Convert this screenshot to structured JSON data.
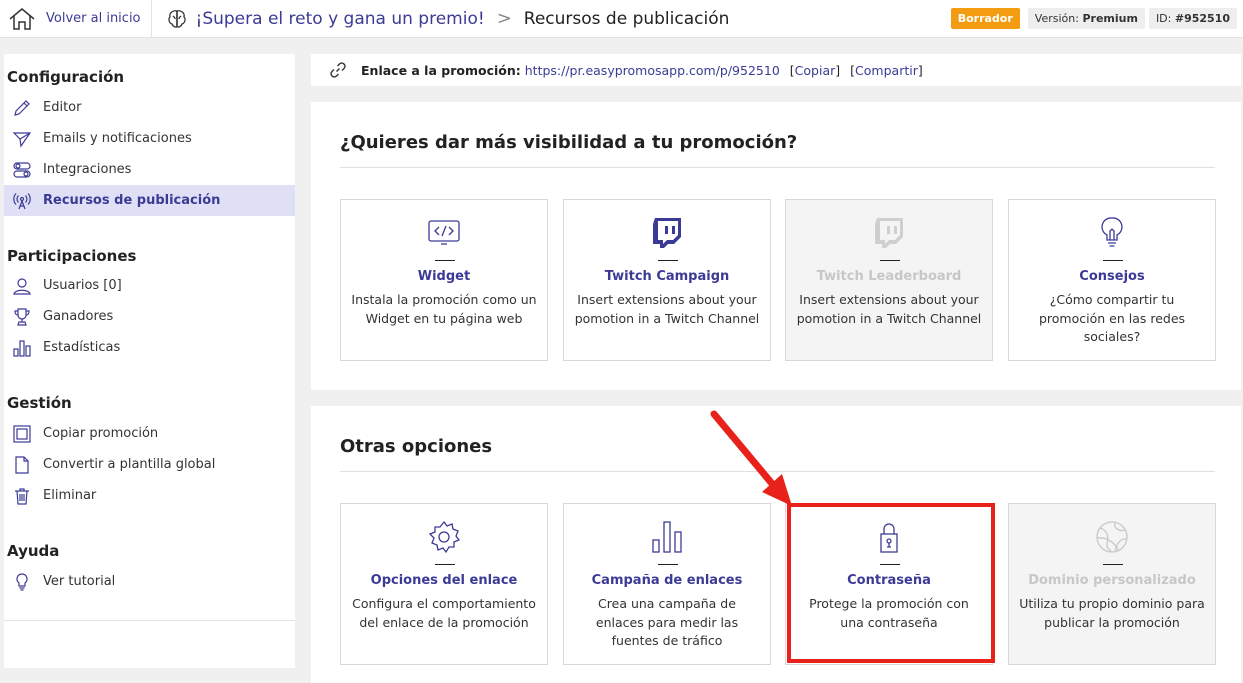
{
  "topbar": {
    "back_label": "Volver al inicio",
    "promo_title": "¡Supera el reto y gana un premio!",
    "separator": ">",
    "current_page": "Recursos de publicación",
    "status_badge": "Borrador",
    "version_label": "Versión:",
    "version_value": "Premium",
    "id_label": "ID:",
    "id_value": "#952510"
  },
  "sidebar": {
    "sections": [
      {
        "title": "Configuración",
        "items": [
          {
            "label": "Editor",
            "icon": "pencil-icon"
          },
          {
            "label": "Emails y notificaciones",
            "icon": "send-icon"
          },
          {
            "label": "Integraciones",
            "icon": "toggles-icon"
          },
          {
            "label": "Recursos de publicación",
            "icon": "broadcast-icon",
            "active": true
          }
        ]
      },
      {
        "title": "Participaciones",
        "items": [
          {
            "label": "Usuarios [0]",
            "icon": "user-icon"
          },
          {
            "label": "Ganadores",
            "icon": "trophy-icon"
          },
          {
            "label": "Estadísticas",
            "icon": "bar-chart-icon"
          }
        ]
      },
      {
        "title": "Gestión",
        "items": [
          {
            "label": "Copiar promoción",
            "icon": "copy-icon"
          },
          {
            "label": "Convertir a plantilla global",
            "icon": "document-icon"
          },
          {
            "label": "Eliminar",
            "icon": "trash-icon"
          }
        ]
      },
      {
        "title": "Ayuda",
        "items": [
          {
            "label": "Ver tutorial",
            "icon": "lightbulb-icon"
          }
        ]
      }
    ]
  },
  "linkbar": {
    "label": "Enlace a la promoción:",
    "url": "https://pr.easypromosapp.com/p/952510",
    "copy_label": "Copiar",
    "share_label": "Compartir"
  },
  "visibility": {
    "title": "¿Quieres dar más visibilidad a tu promoción?",
    "cards": [
      {
        "title": "Widget",
        "desc": "Instala la promoción como un Widget en tu página web",
        "icon": "code-icon",
        "disabled": false
      },
      {
        "title": "Twitch Campaign",
        "desc": "Insert extensions about your pomotion in a Twitch Channel",
        "icon": "twitch-icon",
        "disabled": false
      },
      {
        "title": "Twitch Leaderboard",
        "desc": "Insert extensions about your pomotion in a Twitch Channel",
        "icon": "twitch-icon",
        "disabled": true
      },
      {
        "title": "Consejos",
        "desc": "¿Cómo compartir tu promoción en las redes sociales?",
        "icon": "lightbulb-icon",
        "disabled": false
      }
    ]
  },
  "other": {
    "title": "Otras opciones",
    "cards": [
      {
        "title": "Opciones del enlace",
        "desc": "Configura el comportamiento del enlace de la promoción",
        "icon": "gear-icon",
        "disabled": false
      },
      {
        "title": "Campaña de enlaces",
        "desc": "Crea una campaña de enlaces para medir las fuentes de tráfico",
        "icon": "bar-chart-icon",
        "disabled": false
      },
      {
        "title": "Contraseña",
        "desc": "Protege la promoción con una contraseña",
        "icon": "lock-icon",
        "disabled": false
      },
      {
        "title": "Dominio personalizado",
        "desc": "Utiliza tu propio dominio para publicar la promoción",
        "icon": "globe-icon",
        "disabled": true
      }
    ]
  },
  "colors": {
    "accent": "#3b3b96",
    "draft_badge": "#f39c12",
    "highlight": "#e8221b",
    "active_bg": "#dfe0f5"
  }
}
